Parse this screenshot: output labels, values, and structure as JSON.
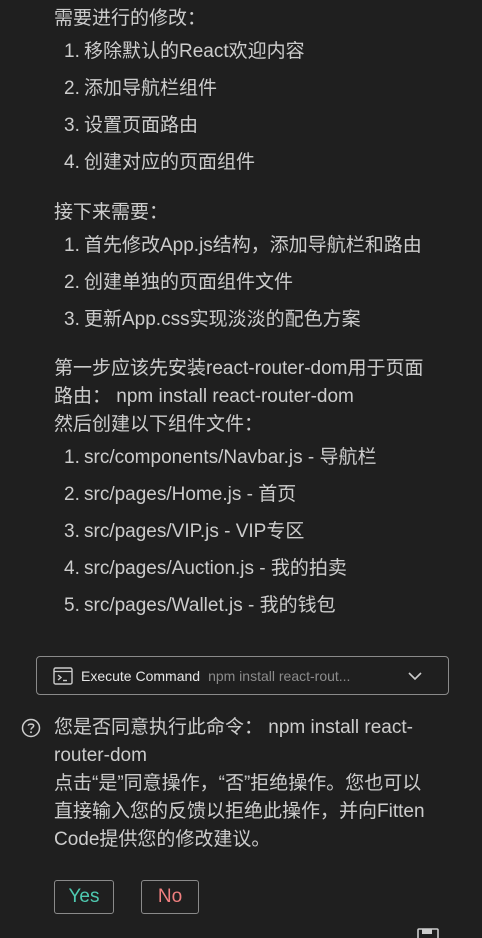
{
  "intro": {
    "heading": "需要进行的修改：",
    "items": [
      {
        "num": "1.",
        "text": "移除默认的React欢迎内容"
      },
      {
        "num": "2.",
        "text": "添加导航栏组件"
      },
      {
        "num": "3.",
        "text": "设置页面路由"
      },
      {
        "num": "4.",
        "text": "创建对应的页面组件"
      }
    ]
  },
  "next": {
    "heading": "接下来需要：",
    "items": [
      {
        "num": "1.",
        "text": "首先修改App.js结构，添加导航栏和路由"
      },
      {
        "num": "2.",
        "text": "创建单独的页面组件文件"
      },
      {
        "num": "3.",
        "text": "更新App.css实现淡淡的配色方案"
      }
    ]
  },
  "step": {
    "line1": "第一步应该先安装react-router-dom用于页面",
    "line2": "路由：  npm install react-router-dom",
    "line3": "然后创建以下组件文件：",
    "items": [
      {
        "num": "1.",
        "text": "src/components/Navbar.js - 导航栏"
      },
      {
        "num": "2.",
        "text": "src/pages/Home.js - 首页"
      },
      {
        "num": "3.",
        "text": "src/pages/VIP.js - VIP专区"
      },
      {
        "num": "4.",
        "text": "src/pages/Auction.js - 我的拍卖"
      },
      {
        "num": "5.",
        "text": "src/pages/Wallet.js - 我的钱包"
      }
    ]
  },
  "command": {
    "title": "Execute Command",
    "preview": "npm install react-rout..."
  },
  "question": {
    "line1": "您是否同意执行此命令：  npm install react-",
    "line2": "router-dom",
    "line3": "点击“是”同意操作，“否”拒绝操作。您也可以",
    "line4": "直接输入您的反馈以拒绝此操作，并向Fitten",
    "line5": "Code提供您的修改建议。"
  },
  "buttons": {
    "yes": "Yes",
    "no": "No"
  },
  "colors": {
    "background": "#1f1f1f",
    "text": "#cccccc",
    "yes": "#4ec9b0",
    "no": "#f07f7f",
    "border": "#8a8a8a"
  },
  "icons": {
    "terminal": "terminal-icon",
    "chevron": "chevron-down-icon",
    "question": "question-circle-icon",
    "save": "save-icon"
  }
}
